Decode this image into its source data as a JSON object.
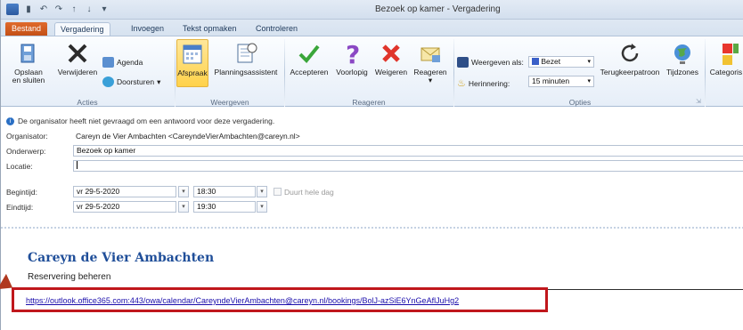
{
  "window": {
    "title": "Bezoek op kamer - Vergadering"
  },
  "tabs": [
    "Bestand",
    "Vergadering",
    "Invoegen",
    "Tekst opmaken",
    "Controleren"
  ],
  "ribbon": {
    "acties": {
      "label": "Acties",
      "opslaan": "Opslaan",
      "opslaan2": "en sluiten",
      "verwijderen": "Verwijderen",
      "agenda": "Agenda",
      "doorsturen": "Doorsturen"
    },
    "weergeven": {
      "label": "Weergeven",
      "afspraak": "Afspraak",
      "planningsassistent": "Planningsassistent"
    },
    "reageren": {
      "label": "Reageren",
      "accepteren": "Accepteren",
      "voorlopig": "Voorlopig",
      "weigeren": "Weigeren",
      "reageren_btn": "Reageren"
    },
    "opties": {
      "label": "Opties",
      "weergeven_als": "Weergeven als:",
      "weergeven_als_value": "Bezet",
      "herinnering": "Herinnering:",
      "herinnering_value": "15 minuten",
      "terugkeerpatroon": "Terugkeerpatroon",
      "tijdzones": "Tijdzones"
    },
    "categoris": "Categoris"
  },
  "colors": {
    "accent": "#1f4e99",
    "file_tab": "#c24e15",
    "highlight_box": "#c0171c",
    "busy": "#3a5fc8"
  },
  "form": {
    "info": "De organisator heeft niet gevraagd om een antwoord voor deze vergadering.",
    "organisator_label": "Organisator:",
    "organisator_value": "Careyn de Vier Ambachten <CareyndeVierAmbachten@careyn.nl>",
    "onderwerp_label": "Onderwerp:",
    "onderwerp_value": "Bezoek op kamer",
    "locatie_label": "Locatie:",
    "locatie_value": "",
    "begintijd_label": "Begintijd:",
    "begin_date": "vr 29-5-2020",
    "begin_time": "18:30",
    "duurt_hele_dag": "Duurt hele dag",
    "eindtijd_label": "Eindtijd:",
    "end_date": "vr 29-5-2020",
    "end_time": "19:30"
  },
  "body": {
    "org_title": "Careyn de Vier Ambachten",
    "reservering": "Reservering beheren",
    "link": "https://outlook.office365.com:443/owa/calendar/CareyndeVierAmbachten@careyn.nl/bookings/BolJ-azSiE6YnGeAflJuHg2"
  }
}
